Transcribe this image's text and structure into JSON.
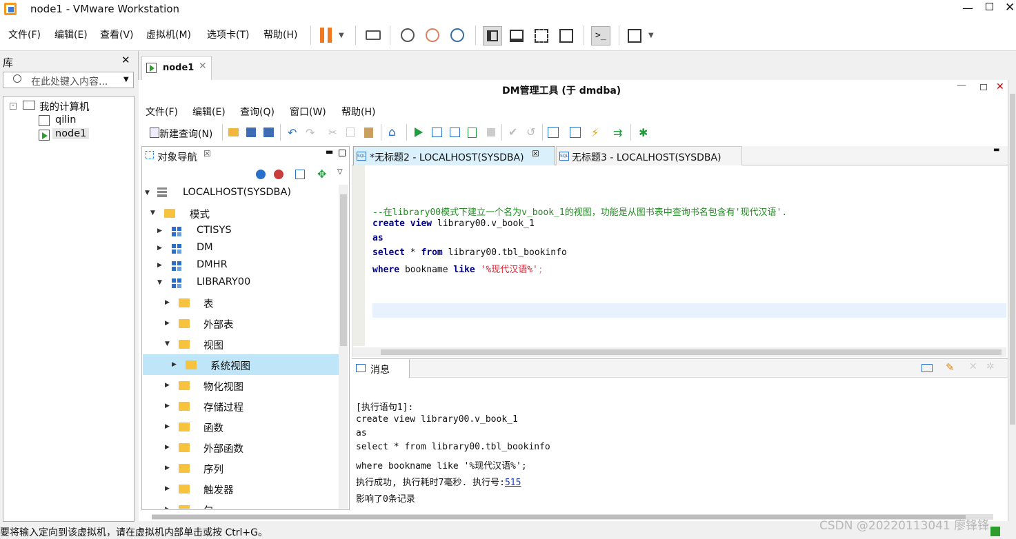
{
  "vm": {
    "title": "node1 - VMware Workstation",
    "menu": [
      "文件(F)",
      "编辑(E)",
      "查看(V)",
      "虚拟机(M)",
      "选项卡(T)",
      "帮助(H)"
    ],
    "status": "要将输入定向到该虚拟机，请在虚拟机内部单击或按 Ctrl+G。",
    "watermark": "CSDN @20220113041 廖锋锋"
  },
  "library": {
    "title": "库",
    "search_placeholder": "在此处键入内容...",
    "root": "我的计算机",
    "items": [
      "qilin",
      "node1"
    ]
  },
  "vm_tab": {
    "label": "node1"
  },
  "dm": {
    "title": "DM管理工具 (于 dmdba)",
    "menu": [
      "文件(F)",
      "编辑(E)",
      "查询(Q)",
      "窗口(W)",
      "帮助(H)"
    ],
    "new_query": "新建查询(N)"
  },
  "nav": {
    "title": "对象导航",
    "tree": {
      "server": "LOCALHOST(SYSDBA)",
      "schema_group": "模式",
      "schemas": [
        "CTISYS",
        "DM",
        "DMHR",
        "LIBRARY00"
      ],
      "library_children": [
        "表",
        "外部表",
        "视图",
        "系统视图",
        "物化视图",
        "存储过程",
        "函数",
        "外部函数",
        "序列",
        "触发器",
        "包"
      ]
    }
  },
  "editor": {
    "tabs": [
      "*无标题2 - LOCALHOST(SYSDBA)",
      "无标题3 - LOCALHOST(SYSDBA)"
    ],
    "comment": "--在library00模式下建立一个名为v_book_1的视图，功能是从图书表中查询书名包含有'现代汉语'.",
    "kw_create": "create",
    "kw_view": "view",
    "line1_rest": " library00.v_book_1",
    "kw_as": "as",
    "kw_select": "select",
    "line3_mid": " * ",
    "kw_from": "from",
    "line3_rest": " library00.tbl_bookinfo",
    "kw_where": "where",
    "line4_mid": " bookname ",
    "kw_like": "like",
    "str_value": "'%现代汉语%'",
    "semicolon": ";"
  },
  "messages": {
    "title": "消息",
    "lines": [
      "[执行语句1]:",
      "create view library00.v_book_1",
      "as",
      "select * from library00.tbl_bookinfo",
      "where bookname like '%现代汉语%';"
    ],
    "result_prefix": "执行成功, 执行耗时7毫秒. 执行号:",
    "exec_no": "515",
    "affected": "影响了0条记录"
  }
}
